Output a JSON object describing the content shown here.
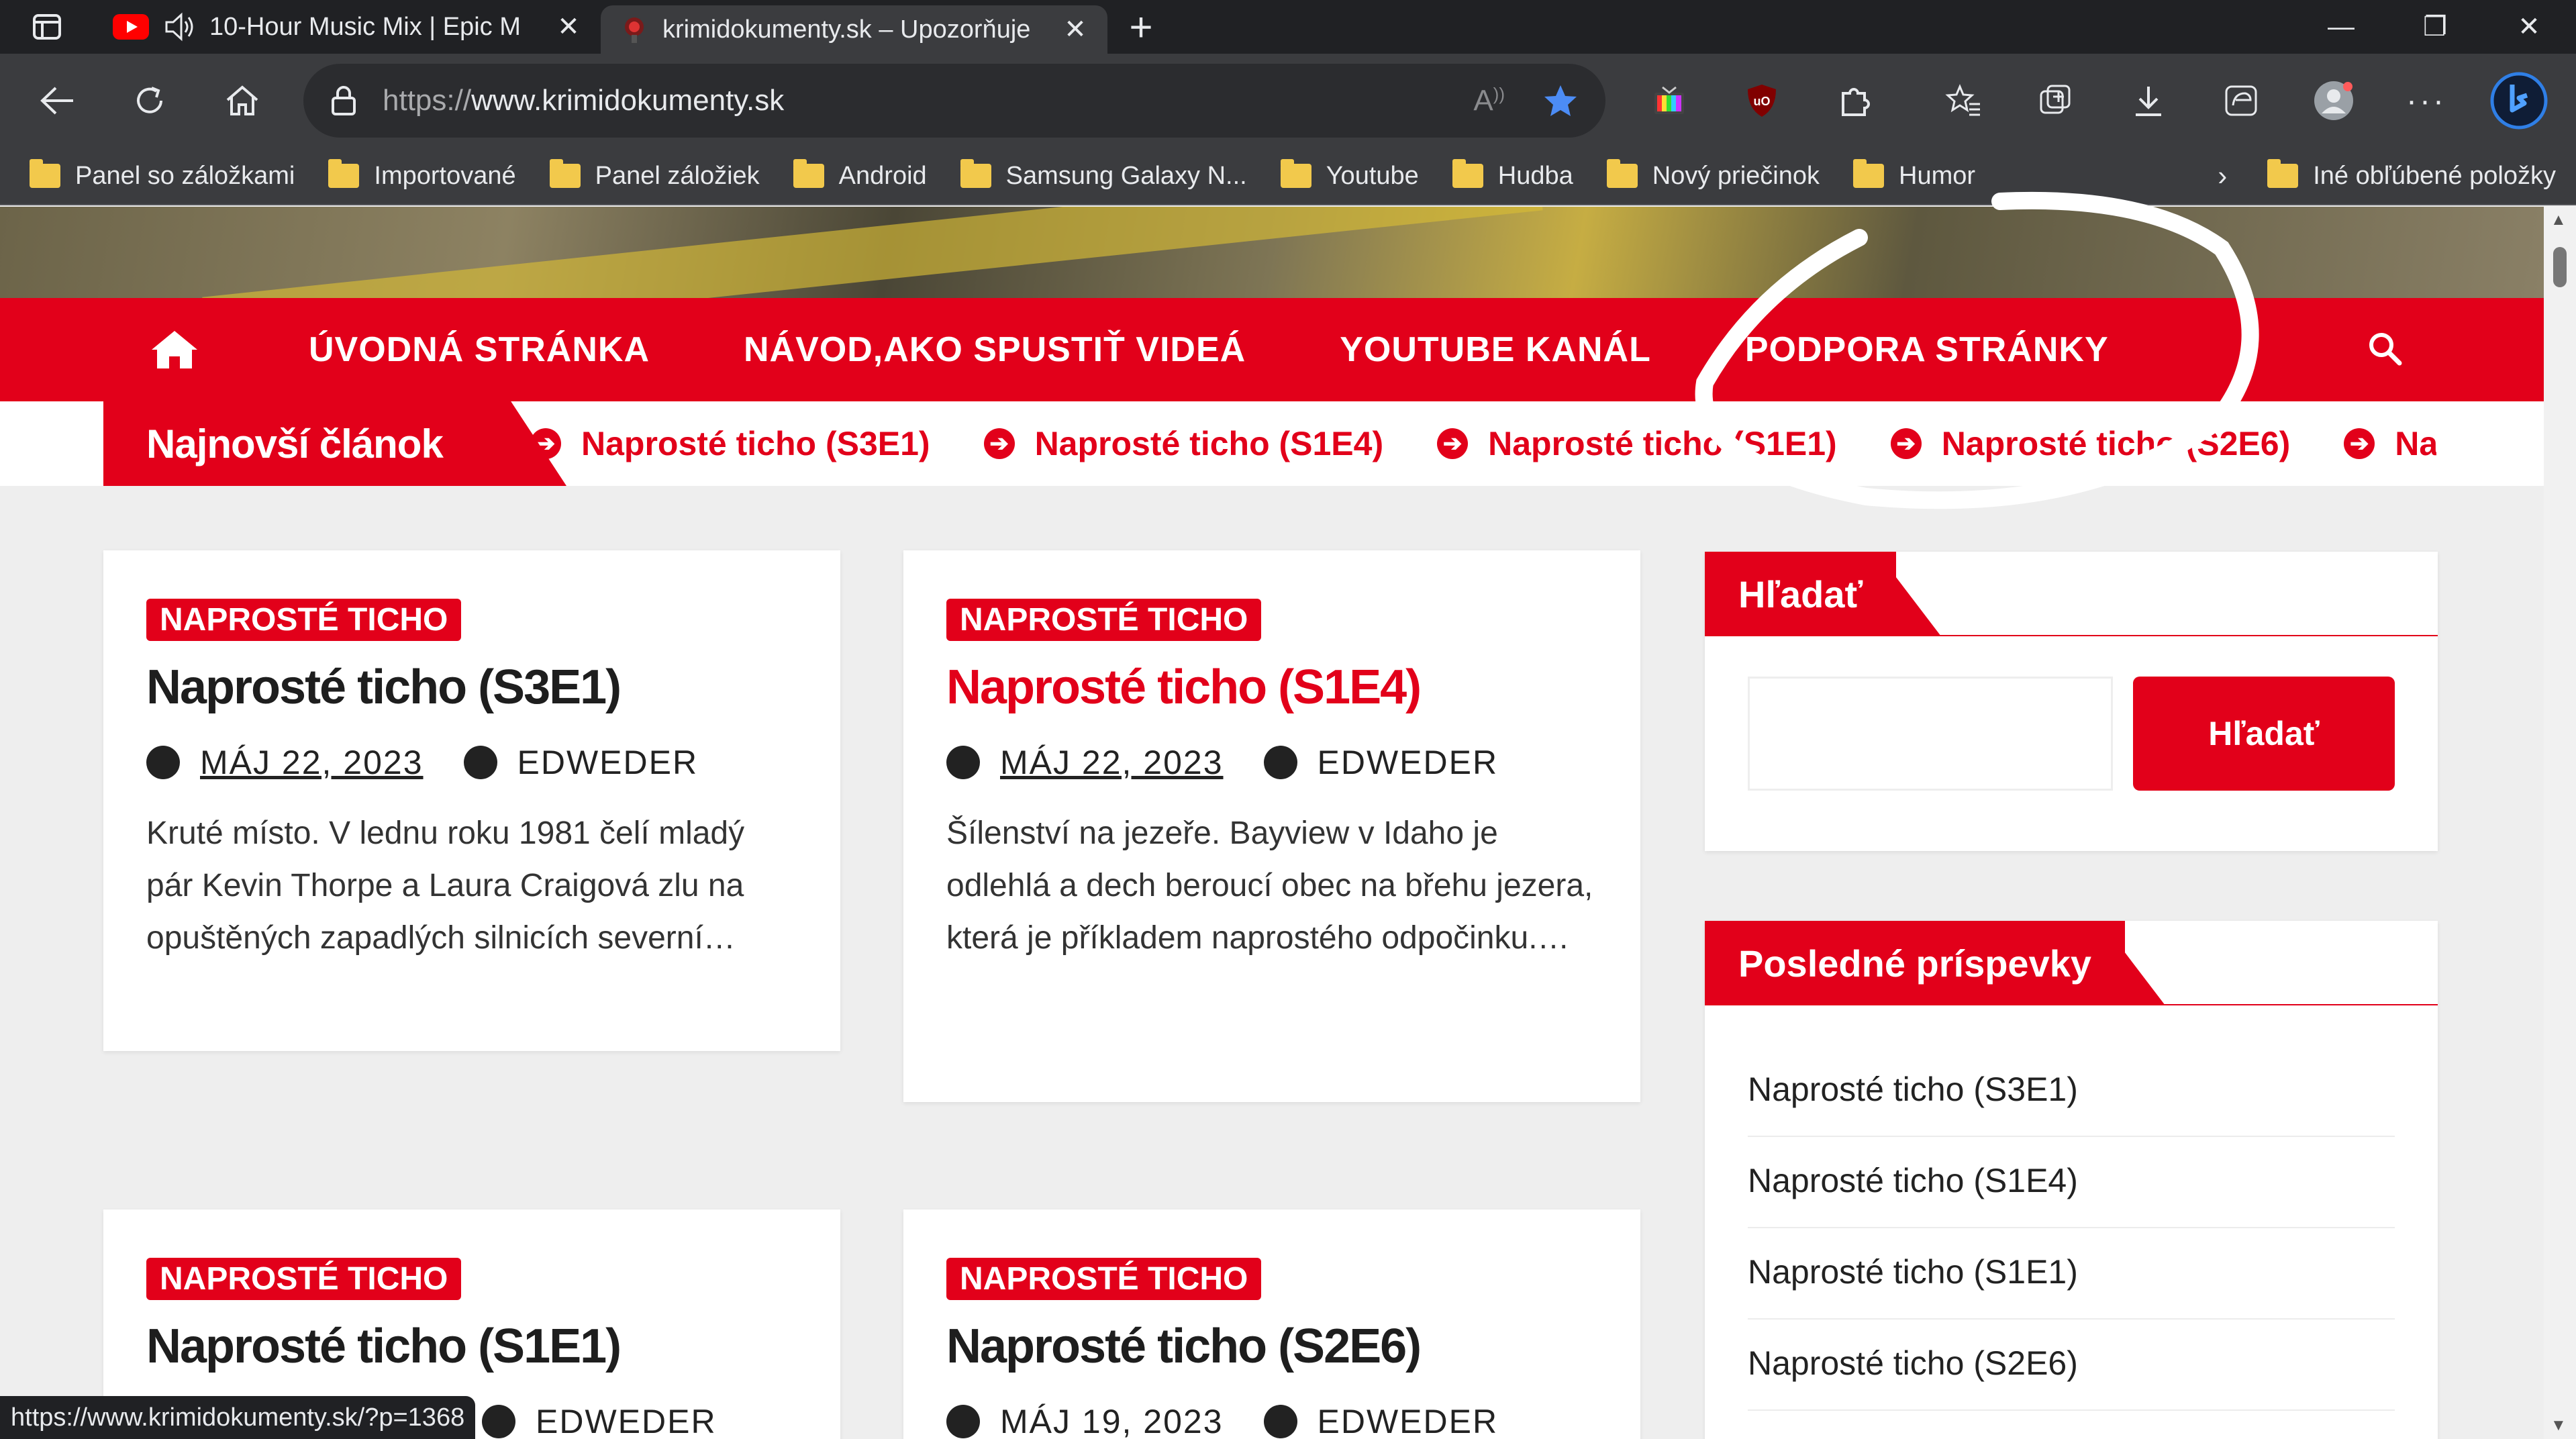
{
  "browser": {
    "tabs": [
      {
        "title": "10-Hour Music Mix | Epic M",
        "active": false
      },
      {
        "title": "krimidokumenty.sk – Upozorňuje",
        "active": true
      }
    ],
    "address": {
      "proto": "https://",
      "host": "www.krimidokumenty.sk"
    },
    "bookmarks": [
      "Panel so záložkami",
      "Importované",
      "Panel záložiek",
      "Android",
      "Samsung Galaxy N...",
      "Youtube",
      "Hudba",
      "Nový priečinok",
      "Humor"
    ],
    "other_bookmarks": "Iné obľúbené položky",
    "status_url": "https://www.krimidokumenty.sk/?p=1368"
  },
  "site": {
    "nav": [
      "ÚVODNÁ STRÁNKA",
      "NÁVOD,AKO SPUSTIŤ VIDEÁ",
      "YOUTUBE KANÁL",
      "PODPORA STRÁNKY"
    ],
    "ticker": {
      "label": "Najnovší článok",
      "items": [
        "Naprosté ticho (S3E1)",
        "Naprosté ticho (S1E4)",
        "Naprosté ticho (S1E1)",
        "Naprosté ticho (S2E6)",
        "Napr"
      ]
    },
    "posts": [
      {
        "category": "NAPROSTÉ TICHO",
        "title": "Naprosté ticho (S3E1)",
        "date": "MÁJ 22, 2023",
        "author": "EDWEDER",
        "excerpt": "Kruté místo. V lednu roku 1981 čelí mladý pár Kevin Thorpe a Laura Craigová zlu na opuštěných zapadlých silnicích severní…"
      },
      {
        "category": "NAPROSTÉ TICHO",
        "title": "Naprosté ticho (S1E4)",
        "date": "MÁJ 22, 2023",
        "author": "EDWEDER",
        "excerpt": "Šílenství na jezeře. Bayview v Idaho je odlehlá a dech beroucí obec na břehu jezera, která je příkladem naprostého odpočinku.…"
      },
      {
        "category": "NAPROSTÉ TICHO",
        "title": "Naprosté ticho (S1E1)",
        "date": "",
        "author": "EDWEDER",
        "excerpt": ""
      },
      {
        "category": "NAPROSTÉ TICHO",
        "title": "Naprosté ticho (S2E6)",
        "date": "MÁJ 19, 2023",
        "author": "EDWEDER",
        "excerpt": ""
      }
    ],
    "sidebar": {
      "search_title": "Hľadať",
      "search_button": "Hľadať",
      "recent_title": "Posledné príspevky",
      "recent": [
        "Naprosté ticho (S3E1)",
        "Naprosté ticho (S1E4)",
        "Naprosté ticho (S1E1)",
        "Naprosté ticho (S2E6)"
      ]
    }
  },
  "colors": {
    "brand_red": "#e2001a",
    "chrome_dark": "#202124",
    "chrome_mid": "#3b3c3f"
  }
}
